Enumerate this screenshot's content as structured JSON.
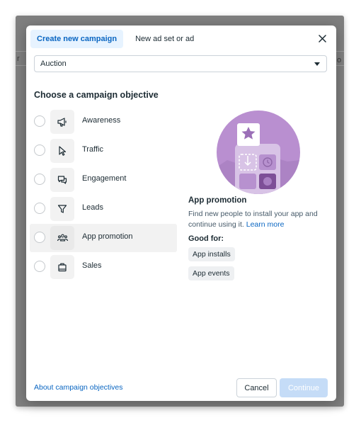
{
  "tabs": [
    {
      "label": "Create new campaign",
      "active": true
    },
    {
      "label": "New ad set or ad",
      "active": false
    }
  ],
  "close_icon": "close-icon",
  "buying_type": {
    "value": "Auction",
    "icon": "chevron-down-icon"
  },
  "heading": "Choose a campaign objective",
  "objectives": [
    {
      "label": "Awareness",
      "icon": "megaphone-icon"
    },
    {
      "label": "Traffic",
      "icon": "cursor-icon"
    },
    {
      "label": "Engagement",
      "icon": "chat-bubbles-icon"
    },
    {
      "label": "Leads",
      "icon": "funnel-icon"
    },
    {
      "label": "App promotion",
      "icon": "people-icon",
      "selected": true
    },
    {
      "label": "Sales",
      "icon": "shopping-bag-icon"
    }
  ],
  "detail": {
    "title": "App promotion",
    "description": "Find new people to install your app and continue using it.",
    "learn_more": "Learn more",
    "good_for_label": "Good for:",
    "good_for": [
      "App installs",
      "App events"
    ]
  },
  "footer": {
    "about_link": "About campaign objectives",
    "cancel": "Cancel",
    "continue": "Continue"
  },
  "colors": {
    "accent": "#0a66c2",
    "active_tab_bg": "#e7f3ff",
    "illustration_purple": "#b98fd0",
    "disabled_button": "#c5dcf7"
  }
}
